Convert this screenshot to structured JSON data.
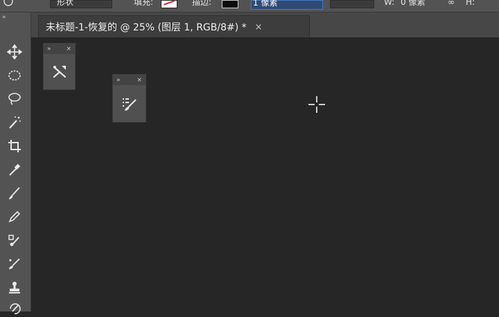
{
  "options_bar": {
    "shape_mode": "形状",
    "fill_label": "填充:",
    "stroke_label": "描边:",
    "stroke_width": "1 像素",
    "w_label": "W:",
    "w_value": "0 像素",
    "h_label": "H:"
  },
  "document": {
    "tab_title": "未标题-1-恢复的 @ 25% (图层 1, RGB/8#) *",
    "close_glyph": "×"
  },
  "toolbar": {
    "grip": "»",
    "tools": [
      {
        "name": "move-tool-icon"
      },
      {
        "name": "elliptical-marquee-tool-icon"
      },
      {
        "name": "lasso-tool-icon"
      },
      {
        "name": "magic-wand-tool-icon"
      },
      {
        "name": "crop-tool-icon"
      },
      {
        "name": "eyedropper-tool-icon"
      },
      {
        "name": "brush-tool-icon"
      },
      {
        "name": "pencil-tool-icon"
      },
      {
        "name": "healing-brush-tool-icon"
      },
      {
        "name": "color-replacement-tool-icon"
      },
      {
        "name": "clone-stamp-tool-icon"
      },
      {
        "name": "history-brush-tool-icon"
      }
    ]
  },
  "panels": {
    "panel1": {
      "expand_glyph": "»",
      "close_glyph": "×",
      "icon": "tool-presets-icon"
    },
    "panel2": {
      "expand_glyph": "»",
      "close_glyph": "×",
      "icon": "brush-presets-icon"
    }
  },
  "colors": {
    "ui_gray": "#535353",
    "canvas_bg": "#262626",
    "accent_blue": "#4a78c0",
    "stroke_red": "#d7262e"
  }
}
